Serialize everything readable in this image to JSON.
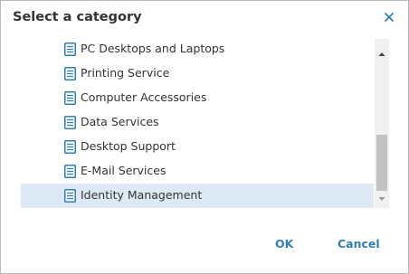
{
  "dialog": {
    "title": "Select a category",
    "close_icon": "close-icon",
    "ok_label": "OK",
    "cancel_label": "Cancel"
  },
  "categories": [
    {
      "label": "PC Desktops and Laptops",
      "icon": "document-icon",
      "selected": false
    },
    {
      "label": "Printing Service",
      "icon": "document-icon",
      "selected": false
    },
    {
      "label": "Computer Accessories",
      "icon": "document-icon",
      "selected": false
    },
    {
      "label": "Data Services",
      "icon": "document-icon",
      "selected": false
    },
    {
      "label": "Desktop Support",
      "icon": "document-icon",
      "selected": false
    },
    {
      "label": "E-Mail Services",
      "icon": "document-icon",
      "selected": false
    },
    {
      "label": "Identity Management",
      "icon": "document-icon",
      "selected": true
    }
  ],
  "colors": {
    "accent": "#2f7fb6",
    "selected_row": "#dde9f5",
    "text": "#333333"
  }
}
